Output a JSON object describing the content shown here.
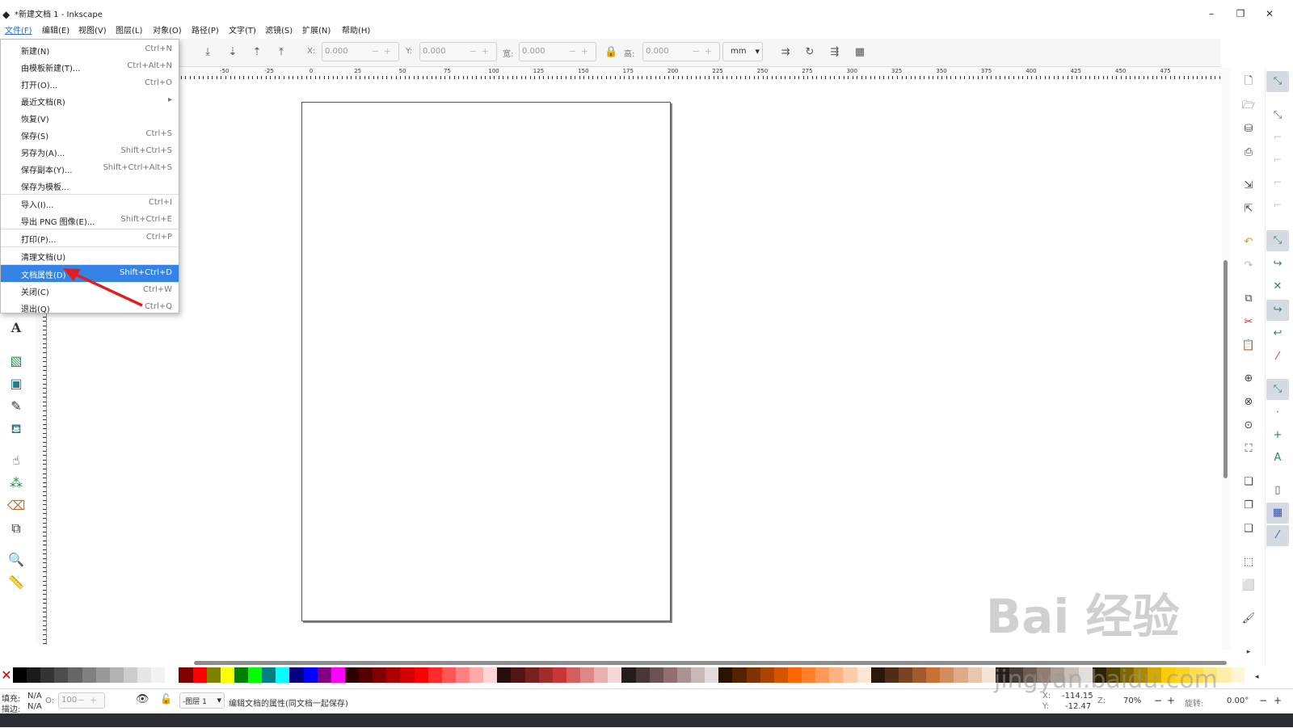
{
  "window": {
    "title": "*新建文档 1 - Inkscape",
    "min_label": "–",
    "max_label": "❐",
    "close_label": "✕"
  },
  "menubar": {
    "items": [
      "文件(F)",
      "编辑(E)",
      "视图(V)",
      "图层(L)",
      "对象(O)",
      "路径(P)",
      "文字(T)",
      "滤镜(S)",
      "扩展(N)",
      "帮助(H)"
    ]
  },
  "toolbar": {
    "x_label": "X:",
    "x_value": "0.000",
    "y_label": "Y:",
    "y_value": "0.000",
    "w_label": "宽:",
    "w_value": "0.000",
    "h_label": "高:",
    "h_value": "0.000",
    "unit": "mm"
  },
  "ruler": {
    "h_labels": [
      "-50",
      "-25",
      "0",
      "25",
      "50",
      "75",
      "100",
      "125",
      "150",
      "175",
      "200",
      "225",
      "250",
      "275",
      "300",
      "325",
      "350",
      "375",
      "400",
      "425",
      "450",
      "475"
    ]
  },
  "file_menu": {
    "items": [
      {
        "label": "新建(N)",
        "shortcut": "Ctrl+N"
      },
      {
        "label": "由模板新建(T)...",
        "shortcut": "Ctrl+Alt+N"
      },
      {
        "label": "打开(O)...",
        "shortcut": "Ctrl+O"
      },
      {
        "label": "最近文档(R)",
        "shortcut": "▸"
      },
      {
        "label": "恢复(V)",
        "shortcut": ""
      },
      {
        "label": "保存(S)",
        "shortcut": "Ctrl+S"
      },
      {
        "label": "另存为(A)...",
        "shortcut": "Shift+Ctrl+S"
      },
      {
        "label": "保存副本(Y)...",
        "shortcut": "Shift+Ctrl+Alt+S"
      },
      {
        "label": "保存为模板...",
        "shortcut": ""
      },
      {
        "label": "导入(I)...",
        "shortcut": "Ctrl+I"
      },
      {
        "label": "导出 PNG 图像(E)...",
        "shortcut": "Shift+Ctrl+E"
      },
      {
        "label": "打印(P)...",
        "shortcut": "Ctrl+P"
      },
      {
        "label": "清理文档(U)",
        "shortcut": ""
      },
      {
        "label": "文档属性(D)",
        "shortcut": "Shift+Ctrl+D"
      },
      {
        "label": "关闭(C)",
        "shortcut": "Ctrl+W"
      },
      {
        "label": "退出(Q)",
        "shortcut": "Ctrl+Q"
      }
    ],
    "highlighted_index": 13
  },
  "status": {
    "fill_label": "填充:",
    "fill_value": "N/A",
    "stroke_label": "描边:",
    "stroke_value": "N/A",
    "opacity_label": "O:",
    "opacity_value": "100",
    "layer": "-图层 1",
    "message": "编辑文档的属性(同文档一起保存)",
    "x_label": "X:",
    "x_value": "-114.15",
    "y_label": "Y:",
    "y_value": "-12.47",
    "z_label": "Z:",
    "zoom": "70%",
    "rotate_label": "旋转:",
    "rotation": "0.00°"
  },
  "watermark": {
    "text": "Bai 经验",
    "url": "jingyan.baidu.com"
  },
  "colors": {
    "accent": "#3583e6",
    "arrow": "#e02020"
  },
  "palette": [
    "#000000",
    "#1a1a1a",
    "#333333",
    "#4d4d4d",
    "#666666",
    "#808080",
    "#999999",
    "#b3b3b3",
    "#cccccc",
    "#e6e6e6",
    "#f2f2f2",
    "#ffffff",
    "#800000",
    "#ff0000",
    "#808000",
    "#ffff00",
    "#008000",
    "#00ff00",
    "#008080",
    "#00ffff",
    "#000080",
    "#0000ff",
    "#800080",
    "#ff00ff",
    "#2b0000",
    "#550000",
    "#800000",
    "#aa0000",
    "#d40000",
    "#ff0000",
    "#ff2a2a",
    "#ff5555",
    "#ff8080",
    "#ffaaaa",
    "#ffd5d5",
    "#280b0b",
    "#501616",
    "#782121",
    "#a02c2c",
    "#c83737",
    "#d35f5f",
    "#de8787",
    "#e9afaf",
    "#f4d7d7",
    "#241c1c",
    "#483737",
    "#6c5353",
    "#916f6f",
    "#ac9393",
    "#c8b7b7",
    "#e3dbdb",
    "#2b1100",
    "#552200",
    "#803300",
    "#aa4400",
    "#d45500",
    "#ff6600",
    "#ff7f2a",
    "#ff9955",
    "#ffb380",
    "#ffccaa",
    "#ffe6d5",
    "#28170b",
    "#502d16",
    "#784421",
    "#a05a2c",
    "#c87137",
    "#d38d5f",
    "#deaa87",
    "#e9c6af",
    "#f4e3d7",
    "#241f1c",
    "#483e37",
    "#6c5d53",
    "#917c6f",
    "#ac9d93",
    "#c8beb7",
    "#e3dedb",
    "#2b2200",
    "#554400",
    "#806600",
    "#aa8800",
    "#d4aa00",
    "#ffcc00",
    "#ffd42a",
    "#ffdd55",
    "#ffe680",
    "#ffeeaa",
    "#fff6d5"
  ]
}
